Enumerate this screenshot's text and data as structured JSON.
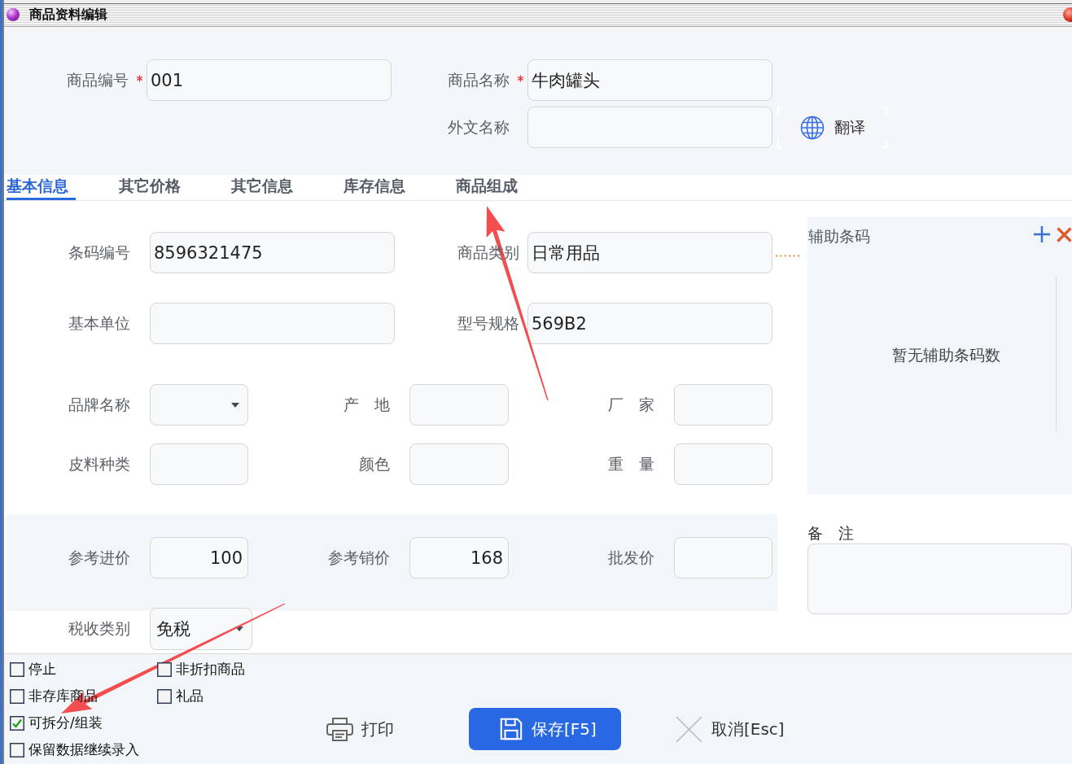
{
  "window": {
    "title": "商品资料编辑"
  },
  "header": {
    "fields": [
      {
        "label": "商品编号",
        "required": true,
        "value": "001"
      },
      {
        "label": "商品名称",
        "required": true,
        "value": "牛肉罐头"
      },
      {
        "label": "外文名称",
        "required": false
      }
    ],
    "translate_button": {
      "label": "翻译"
    }
  },
  "tabs": [
    {
      "label": "基本信息",
      "selected": true,
      "pointed_by_arrow": false
    },
    {
      "label": "其它价格",
      "selected": false,
      "pointed_by_arrow": false
    },
    {
      "label": "其它信息",
      "selected": false,
      "pointed_by_arrow": false
    },
    {
      "label": "库存信息",
      "selected": false,
      "pointed_by_arrow": false
    },
    {
      "label": "商品组成",
      "selected": false,
      "pointed_by_arrow": true
    }
  ],
  "basic_info": {
    "rows": [
      {
        "fields": [
          {
            "kind": "text",
            "label": "条码编号",
            "value": "8596321475"
          },
          {
            "kind": "picker",
            "label": "商品类别",
            "value": "日常用品"
          }
        ]
      },
      {
        "fields": [
          {
            "kind": "text",
            "label": "基本单位"
          },
          {
            "kind": "text",
            "label": "型号规格",
            "value": "569B2"
          }
        ]
      },
      {
        "fields": [
          {
            "kind": "dropdown",
            "label": "品牌名称"
          },
          {
            "kind": "text",
            "label": "产　地"
          },
          {
            "kind": "text",
            "label": "厂　家"
          }
        ]
      },
      {
        "fields": [
          {
            "kind": "text",
            "label": "皮料种类"
          },
          {
            "kind": "text",
            "label": "颜色"
          },
          {
            "kind": "text",
            "label": "重　量"
          }
        ]
      }
    ],
    "aux_barcode": {
      "title": "辅助条码",
      "empty_text": "暂无辅助条码数"
    },
    "price_row": {
      "fields": [
        {
          "kind": "number",
          "label": "参考进价",
          "value": "100"
        },
        {
          "kind": "number",
          "label": "参考销价",
          "value": "168"
        },
        {
          "kind": "number",
          "label": "批发价"
        }
      ]
    },
    "remarks": {
      "label": "备　注"
    },
    "tax_row": {
      "fields": [
        {
          "kind": "dropdown",
          "label": "税收类别",
          "value": "免税"
        }
      ]
    }
  },
  "options": [
    {
      "label": "停止",
      "checked": false,
      "pointed_by_arrow": false
    },
    {
      "label": "非存库商品",
      "checked": false,
      "pointed_by_arrow": false
    },
    {
      "label": "可拆分/组装",
      "checked": true,
      "pointed_by_arrow": true
    },
    {
      "label": "保留数据继续录入",
      "checked": false,
      "pointed_by_arrow": false
    },
    {
      "label": "非折扣商品",
      "checked": false,
      "pointed_by_arrow": false
    },
    {
      "label": "礼品",
      "checked": false,
      "pointed_by_arrow": false
    }
  ],
  "actions": [
    {
      "kind": "print",
      "label": "打印"
    },
    {
      "kind": "save",
      "label": "保存[F5]"
    },
    {
      "kind": "cancel",
      "label": "取消[Esc]"
    }
  ]
}
